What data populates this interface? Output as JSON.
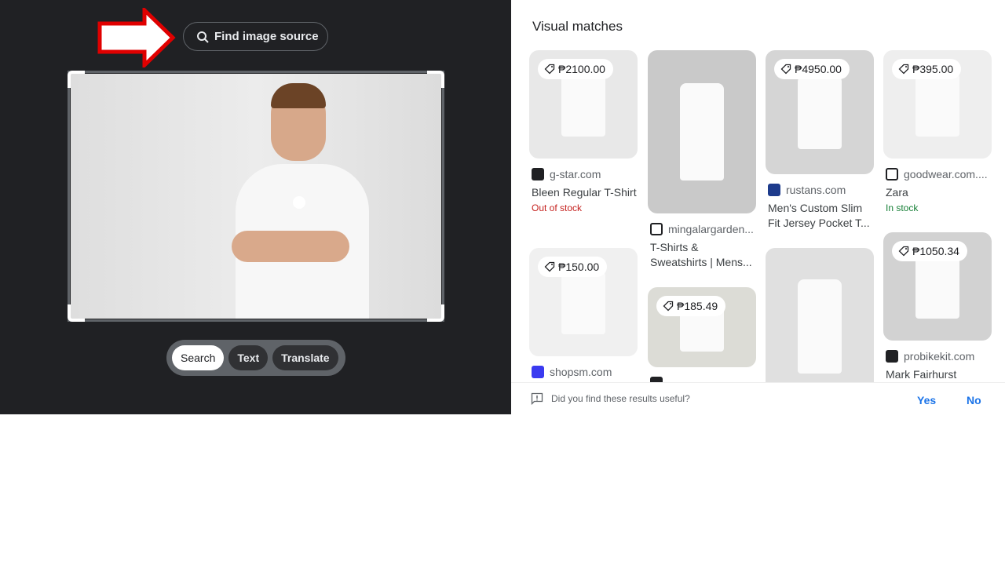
{
  "lens": {
    "find_source_label": "Find image source",
    "modes": [
      {
        "label": "Search",
        "active": true
      },
      {
        "label": "Text",
        "active": false
      },
      {
        "label": "Translate",
        "active": false
      }
    ]
  },
  "annotation": {
    "arrow_color": "#e00000"
  },
  "results": {
    "title": "Visual matches",
    "items": [
      {
        "price": "₱2100.00",
        "source": "g-star.com",
        "title": "Bleen Regular T-Shirt",
        "status": "Out of stock",
        "status_color": "#c5221f"
      },
      {
        "price": "₱150.00",
        "source": "shopsm.com",
        "title": "",
        "status": ""
      },
      {
        "price": "",
        "source": "mingalargarden...",
        "title": "T-Shirts & Sweatshirts | Mens...",
        "status": ""
      },
      {
        "price": "₱185.49",
        "source": "",
        "title": "",
        "status": ""
      },
      {
        "price": "₱4950.00",
        "source": "rustans.com",
        "title": "Men's Custom Slim Fit Jersey Pocket T...",
        "status": ""
      },
      {
        "price": "",
        "source": "",
        "title": "",
        "status": ""
      },
      {
        "price": "₱395.00",
        "source": "goodwear.com....",
        "title": "Zara",
        "status": "In stock",
        "status_color": "#188038"
      },
      {
        "price": "₱1050.34",
        "source": "probikekit.com",
        "title": "Mark Fairhurst",
        "status": ""
      }
    ]
  },
  "feedback": {
    "question": "Did you find these results useful?",
    "yes": "Yes",
    "no": "No"
  }
}
